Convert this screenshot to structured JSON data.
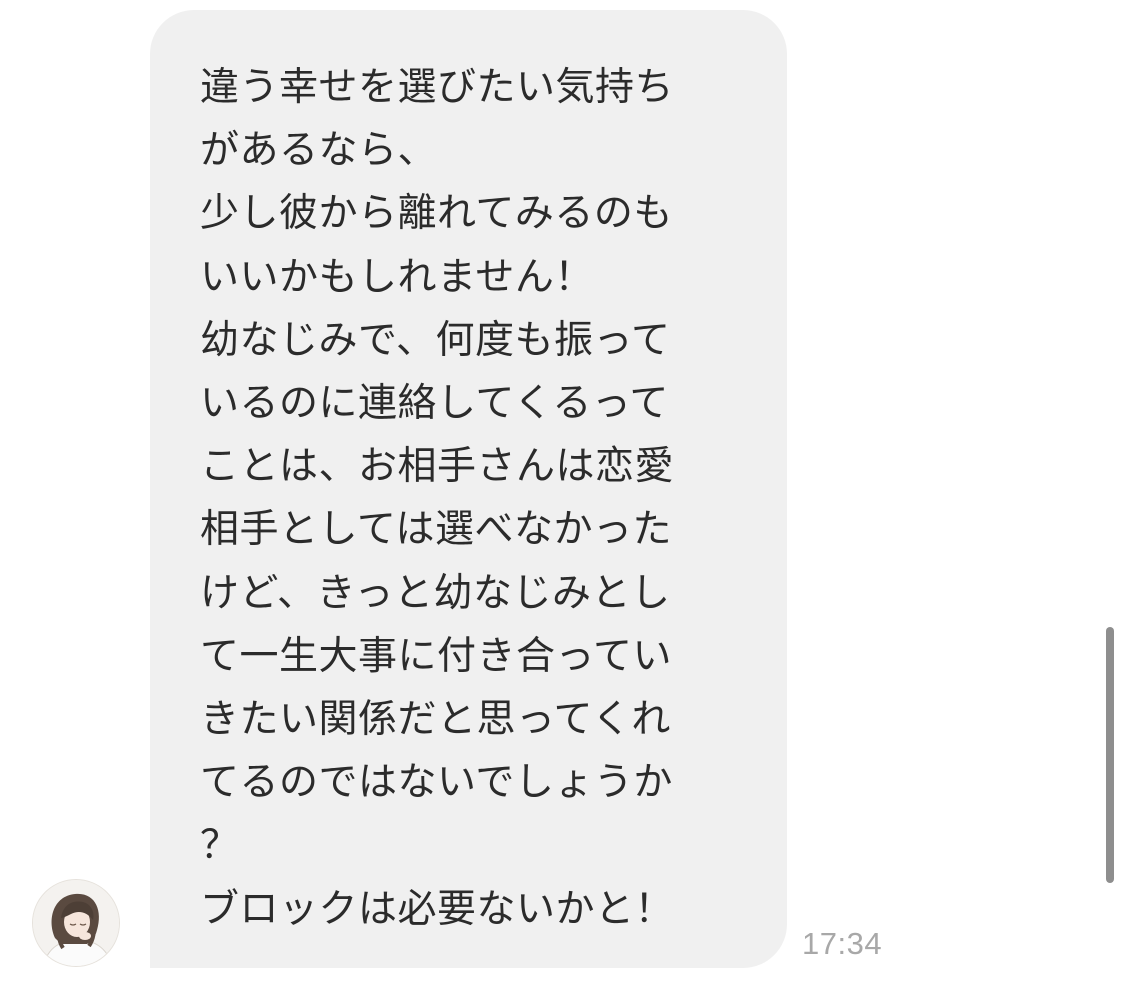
{
  "chat": {
    "message": {
      "lines": [
        "違う幸せを選びたい気持ち",
        "があるなら、",
        "少し彼から離れてみるのも",
        "いいかもしれません！",
        "幼なじみで、何度も振って",
        "いるのに連絡してくるって",
        "ことは、お相手さんは恋愛",
        "相手としては選べなかった",
        "けど、きっと幼なじみとし",
        "て一生大事に付き合ってい",
        "きたい関係だと思ってくれ",
        "てるのではないでしょうか",
        "？",
        "ブロックは必要ないかと！"
      ],
      "time": "17:34"
    },
    "avatar_icon": "user-avatar-illustration"
  },
  "colors": {
    "bubble": "#f0f0f0",
    "text": "#2b2b2b",
    "timestamp": "#a8a8a8",
    "scrollbar": "#8e8e8e",
    "background": "#ffffff"
  }
}
